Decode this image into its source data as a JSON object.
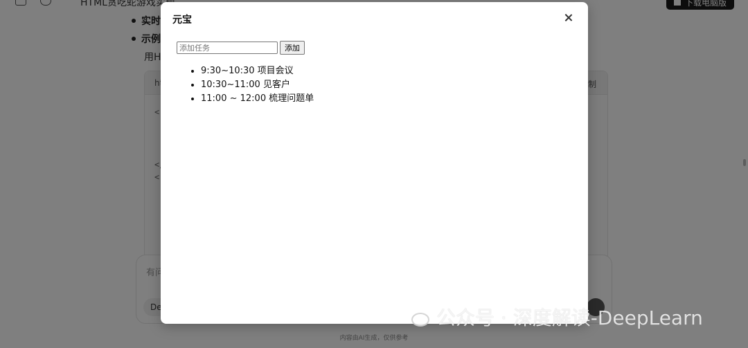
{
  "background": {
    "title": "HTML贪吃蛇游戏实现",
    "download_button": "下载电脑版",
    "bullet1": "实时",
    "bullet2": "示例",
    "plain_text": "用H",
    "code_lang": "ht",
    "code_copy": "制",
    "code_lines": [
      "<",
      "</",
      "<"
    ],
    "input_placeholder": "有问",
    "model_chip": "De",
    "footer": "内容由AI生成，仅供参考"
  },
  "modal": {
    "title": "元宝",
    "task_input_placeholder": "添加任务",
    "add_button": "添加",
    "tasks": [
      "9:30~10:30 项目会议",
      "10:30~11:00 见客户",
      "11:00 ~ 12:00 梳理问题单"
    ]
  },
  "watermark": {
    "text": "公众号 · 深度解读-DeepLearn"
  },
  "colors": {
    "overlay": "#000000",
    "modal_bg": "#ffffff"
  }
}
